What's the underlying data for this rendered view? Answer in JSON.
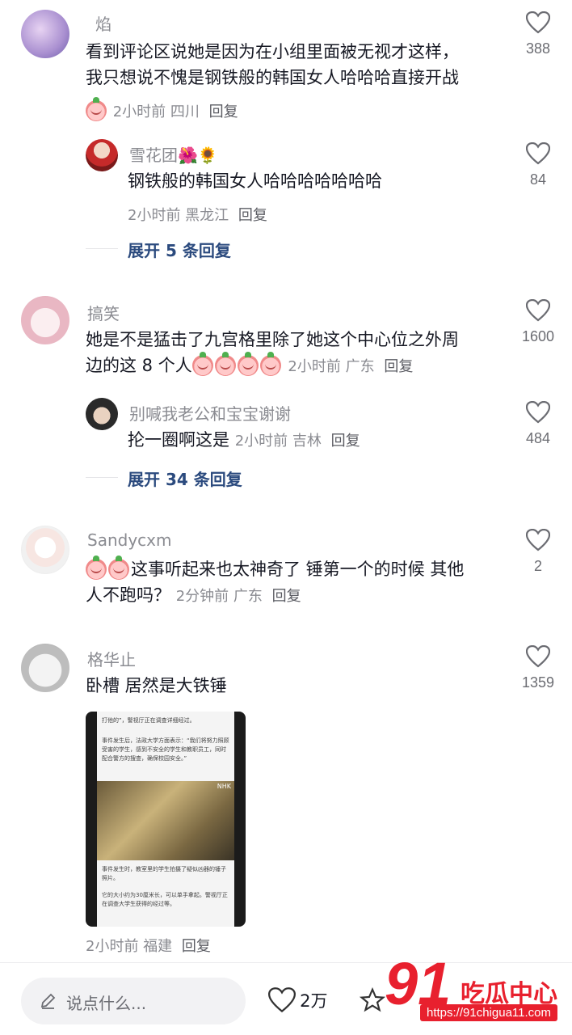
{
  "comments": [
    {
      "username": "焰",
      "text_line1": "看到评论区说她是因为在小组里面被无视才这样，",
      "text_line2": "我只想说不愧是钢铁般的韩国女人哈哈哈直接开战",
      "meta": "2小时前 四川",
      "reply": "回复",
      "likes": "388",
      "sub_reply": {
        "username": "雪花团🌺🌻",
        "text": "钢铁般的韩国女人哈哈哈哈哈哈哈",
        "meta": "2小时前 黑龙江",
        "reply": "回复",
        "likes": "84"
      },
      "expand": "展开 5 条回复"
    },
    {
      "username": "搞笑",
      "text_line1": "她是不是猛击了九宫格里除了她这个中心位之外周",
      "text_line2": "边的这 8 个人",
      "meta": "2小时前 广东",
      "reply": "回复",
      "likes": "1600",
      "sub_reply": {
        "username": "别喊我老公和宝宝谢谢",
        "text": "抡一圈啊这是",
        "meta": "2小时前 吉林",
        "reply": "回复",
        "likes": "484"
      },
      "expand": "展开 34 条回复"
    },
    {
      "username": "Sandycxm",
      "text_line1": "这事听起来也太神奇了 锤第一个的时候 其他",
      "text_line2": "人不跑吗？",
      "meta": "2分钟前 广东",
      "reply": "回复",
      "likes": "2"
    },
    {
      "username": "格华止",
      "text_line1": "卧槽 居然是大铁锤",
      "meta": "2小时前 福建",
      "reply": "回复",
      "likes": "1359",
      "image_text_top": "打他的”，警视厅正在调查详细经过。",
      "image_text_2": "事件发生后，法政大学方面表示：“我们将努力照顾受害的学生，感到不安全的学生和教职员工，同时配合警方的搜查，确保校园安全。”",
      "image_text_3": "事件发生时，教室里的学生拍摄了疑似凶器的锤子照片。",
      "image_text_4": "它的大小约为30厘米长，可以单手拿起。警视厅正在调查大学生获得的经过等。",
      "image_logo": "NHK"
    }
  ],
  "bottom_bar": {
    "input_placeholder": "说点什么...",
    "like_count": "2万"
  },
  "watermark": {
    "brand": "吃瓜中心",
    "url": "https://91chigua11.com"
  }
}
